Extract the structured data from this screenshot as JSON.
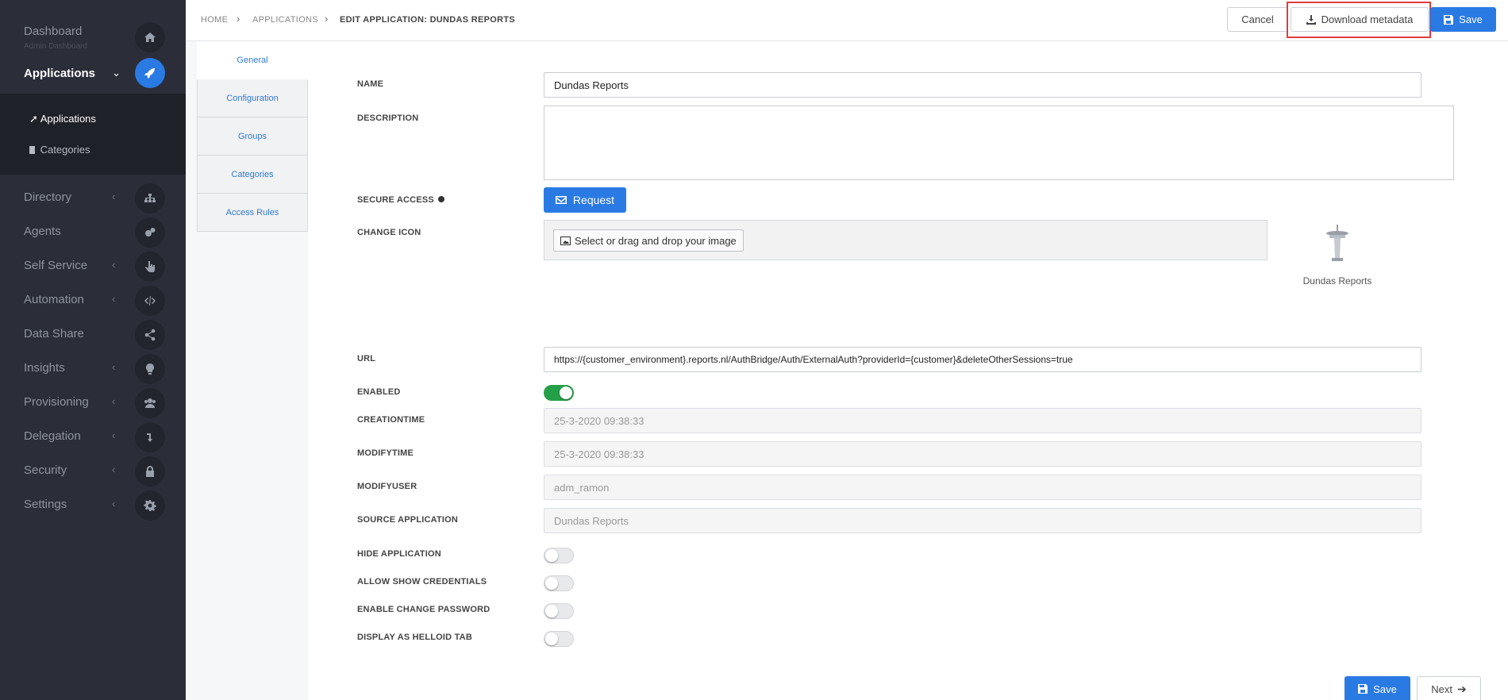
{
  "sidebar": {
    "dashboard": {
      "label": "Dashboard",
      "sub": "Admin Dashboard"
    },
    "applications": {
      "label": "Applications"
    },
    "sub_items": [
      {
        "label": "Applications"
      },
      {
        "label": "Categories"
      }
    ],
    "items": [
      {
        "label": "Directory",
        "icon": "sitemap-icon"
      },
      {
        "label": "Agents",
        "icon": "cogs-icon"
      },
      {
        "label": "Self Service",
        "icon": "hand-pointer-icon"
      },
      {
        "label": "Automation",
        "icon": "code-icon"
      },
      {
        "label": "Data Share",
        "icon": "share-icon"
      },
      {
        "label": "Insights",
        "icon": "lightbulb-icon"
      },
      {
        "label": "Provisioning",
        "icon": "users-icon"
      },
      {
        "label": "Delegation",
        "icon": "level-down-icon"
      },
      {
        "label": "Security",
        "icon": "lock-icon"
      },
      {
        "label": "Settings",
        "icon": "gear-icon"
      }
    ]
  },
  "breadcrumb": {
    "home": "HOME",
    "applications": "APPLICATIONS",
    "current": "EDIT APPLICATION: DUNDAS REPORTS"
  },
  "toolbar": {
    "cancel": "Cancel",
    "download": "Download metadata",
    "save": "Save"
  },
  "tabs": [
    "General",
    "Configuration",
    "Groups",
    "Categories",
    "Access Rules"
  ],
  "form": {
    "name_label": "NAME",
    "name_value": "Dundas Reports",
    "description_label": "DESCRIPTION",
    "secure_access_label": "SECURE ACCESS",
    "request_button": "Request",
    "change_icon_label": "CHANGE ICON",
    "change_icon_button": "Select or drag and drop your image",
    "icon_caption": "Dundas Reports",
    "url_label": "URL",
    "url_value": "https://{customer_environment}.reports.nl/AuthBridge/Auth/ExternalAuth?providerId={customer}&deleteOtherSessions=true",
    "enabled_label": "ENABLED",
    "creationtime_label": "CREATIONTIME",
    "creationtime_value": "25-3-2020 09:38:33",
    "modifytime_label": "MODIFYTIME",
    "modifytime_value": "25-3-2020 09:38:33",
    "modifyuser_label": "MODIFYUSER",
    "modifyuser_value": "adm_ramon",
    "source_label": "SOURCE APPLICATION",
    "source_value": "Dundas Reports",
    "hide_label": "HIDE APPLICATION",
    "allow_cred_label": "ALLOW SHOW CREDENTIALS",
    "enable_change_pw_label": "ENABLE CHANGE PASSWORD",
    "display_tab_label": "DISPLAY AS HELLOID TAB"
  },
  "footer": {
    "save": "Save",
    "next": "Next"
  },
  "colors": {
    "accent": "#2a7ae4",
    "sidebar": "#2b2e38",
    "toggle_on": "#24a148",
    "highlight": "#e03b3b"
  }
}
